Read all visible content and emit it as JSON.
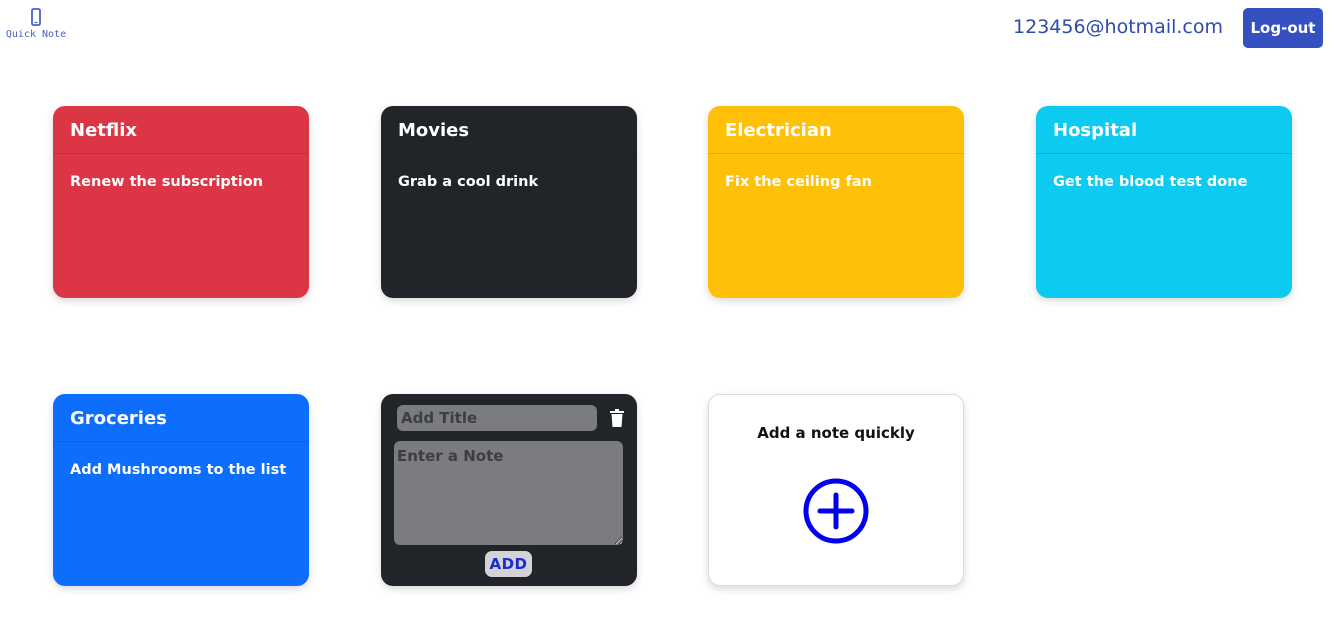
{
  "app": {
    "logo_text": "Quick Note",
    "logo_icon": "phone-icon"
  },
  "header": {
    "user_email": "123456@hotmail.com",
    "logout_label": "Log-out"
  },
  "notes": [
    {
      "title": "Netflix",
      "body": "Renew the subscription",
      "color": "#dc3545"
    },
    {
      "title": "Movies",
      "body": "Grab a cool drink",
      "color": "#212529"
    },
    {
      "title": "Electrician",
      "body": "Fix the ceiling fan",
      "color": "#ffc107"
    },
    {
      "title": "Hospital",
      "body": "Get the blood test done",
      "color": "#0dcaf0"
    },
    {
      "title": "Groceries",
      "body": "Add Mushrooms to the list",
      "color": "#0d6efd"
    }
  ],
  "editor": {
    "title_placeholder": "Add Title",
    "title_value": "",
    "note_placeholder": "Enter a Note",
    "note_value": "",
    "add_label": "ADD",
    "delete_icon": "trash-icon"
  },
  "quick_add": {
    "label": "Add a note quickly",
    "icon": "plus-circle-icon",
    "icon_color": "#0000ee"
  }
}
